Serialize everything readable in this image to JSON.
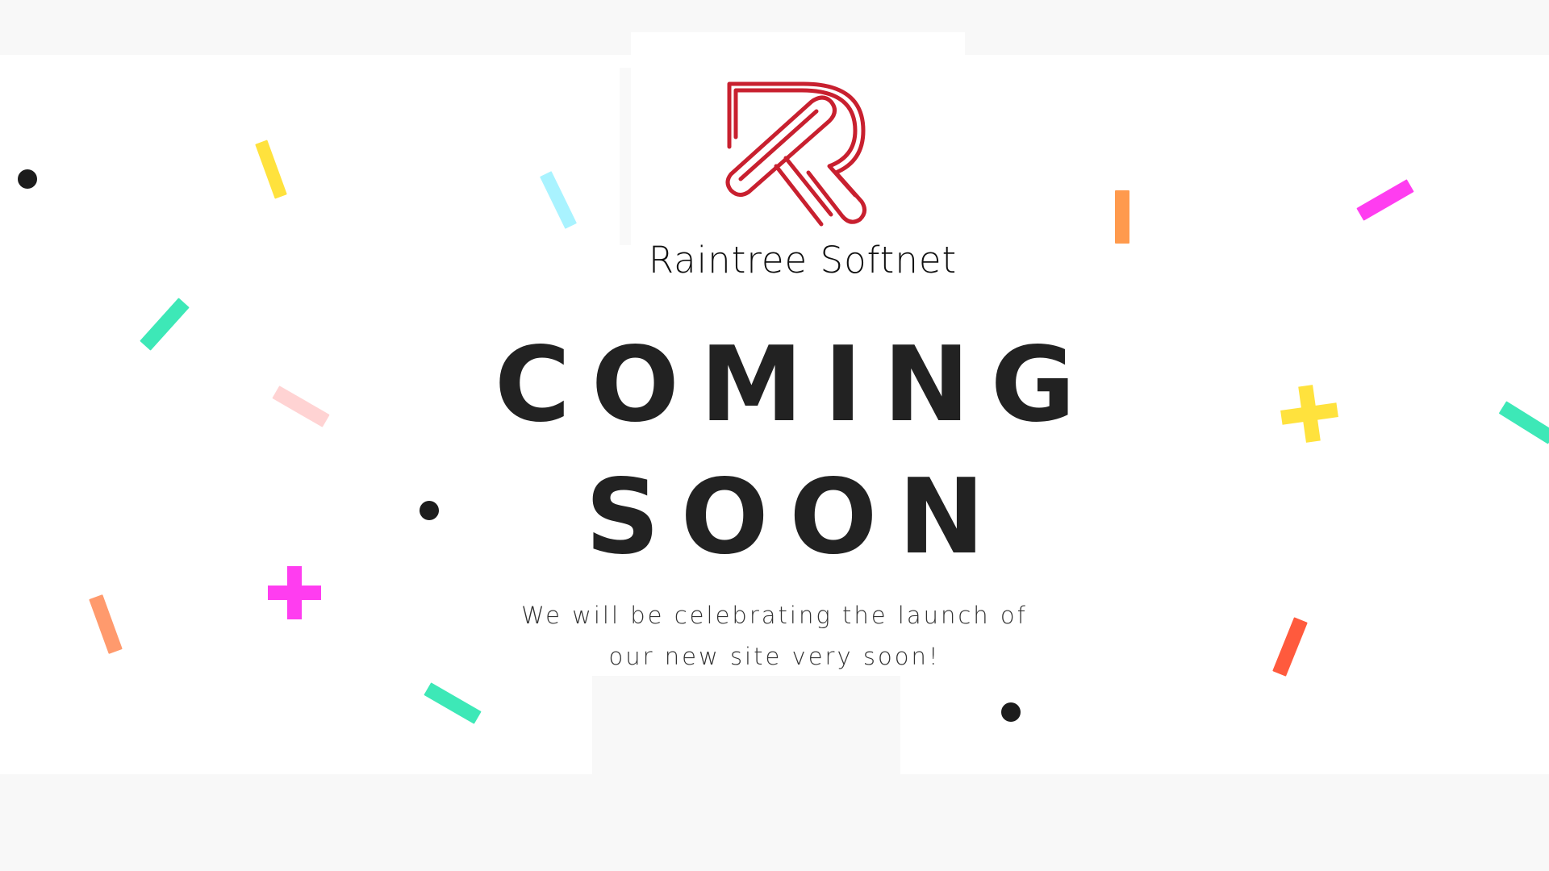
{
  "brand": {
    "name": "Raintree Softnet",
    "logo_icon": "raintree-r-logo",
    "logo_color": "#c8202f"
  },
  "headline": {
    "line1": "COMING",
    "line2": "SOON"
  },
  "subtext": {
    "line1": "We will be celebrating the launch of",
    "line2": "our new site very soon!"
  },
  "colors": {
    "background": "#ffffff",
    "page_margin": "#f8f8f8",
    "text_dark": "#222222",
    "confetti": [
      "#ffe23d",
      "#a9f3ff",
      "#3de8b7",
      "#ff3df0",
      "#ff9a4d",
      "#ffd3d3",
      "#ff5a3d",
      "#1c1c1c"
    ]
  }
}
